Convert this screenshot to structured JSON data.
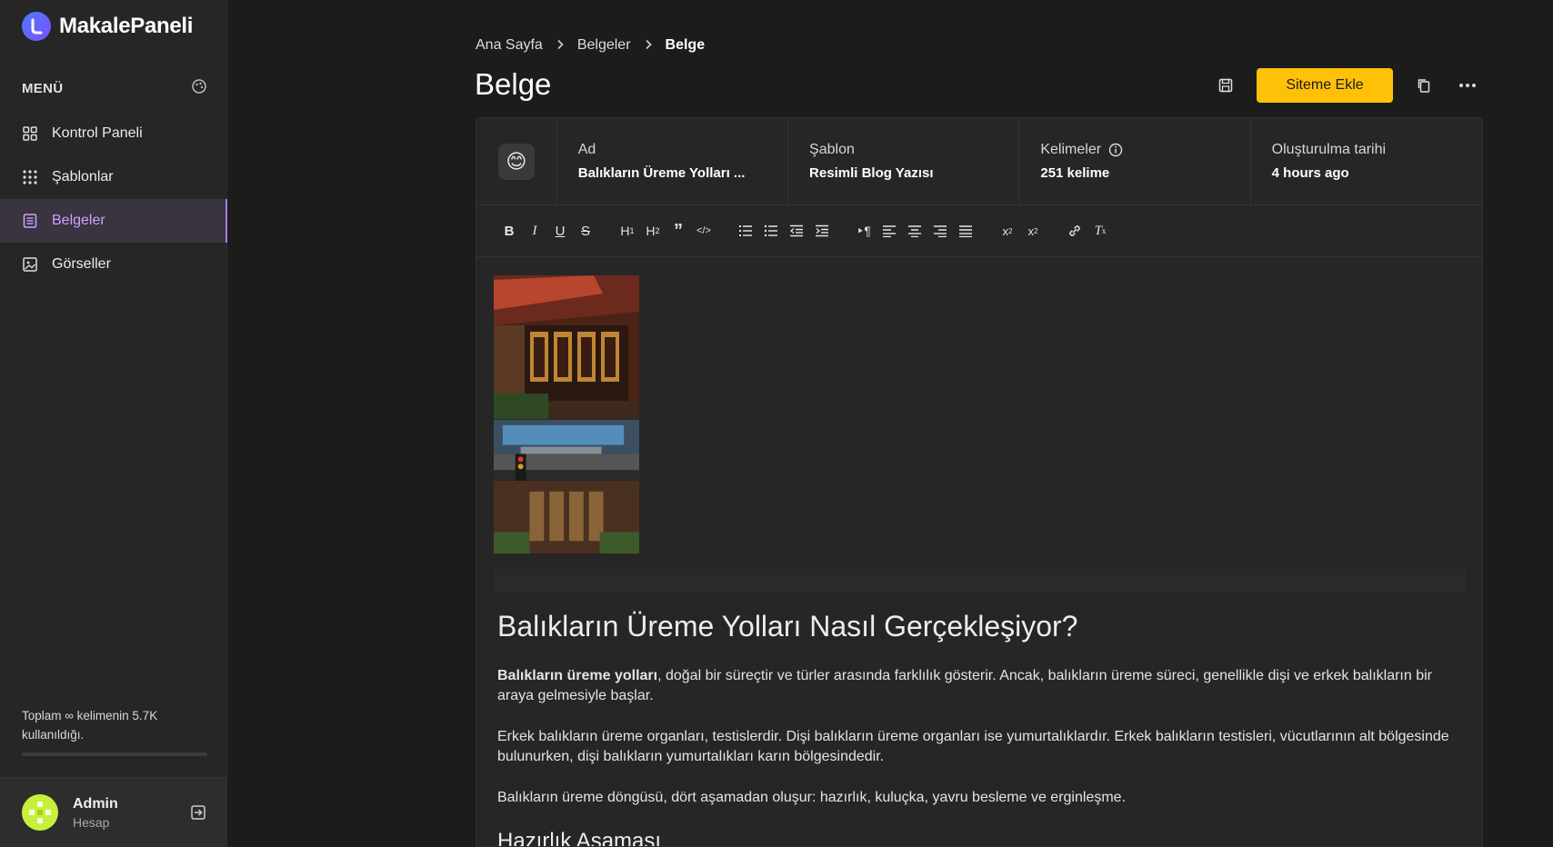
{
  "app": {
    "name": "MakalePaneli"
  },
  "sidebar": {
    "menu_label": "MENÜ",
    "items": [
      {
        "label": "Kontrol Paneli",
        "icon": "grid-icon"
      },
      {
        "label": "Şablonlar",
        "icon": "dots-grid-icon"
      },
      {
        "label": "Belgeler",
        "icon": "document-icon",
        "active": true
      },
      {
        "label": "Görseller",
        "icon": "image-icon"
      }
    ],
    "usage_text": "Toplam ∞ kelimenin 5.7K kullanıldığı.",
    "usage_fraction": 0,
    "user": {
      "name": "Admin",
      "role": "Hesap"
    }
  },
  "breadcrumb": [
    "Ana Sayfa",
    "Belgeler",
    "Belge"
  ],
  "page": {
    "title": "Belge",
    "primary_action": "Siteme Ekle"
  },
  "document": {
    "emoji": "😊",
    "meta": [
      {
        "label": "Ad",
        "value": "Balıkların Üreme Yolları ..."
      },
      {
        "label": "Şablon",
        "value": "Resimli Blog Yazısı"
      },
      {
        "label": "Kelimeler",
        "value": "251 kelime",
        "has_info": true
      },
      {
        "label": "Oluşturulma tarihi",
        "value": "4 hours ago"
      }
    ],
    "toolbar": [
      "B",
      "I",
      "U",
      "S",
      "H1",
      "H2",
      "quote",
      "code",
      "ol",
      "ul",
      "outdent",
      "indent",
      "rtl",
      "align-left",
      "align-center",
      "align-right",
      "justify",
      "sub",
      "sup",
      "link",
      "clear-format"
    ],
    "heading": "Balıkların Üreme Yolları Nasıl Gerçekleşiyor?",
    "p1_bold": "Balıkların üreme yolları",
    "p1_rest": ", doğal bir süreçtir ve türler arasında farklılık gösterir. Ancak, balıkların üreme süreci, genellikle dişi ve erkek balıkların bir araya gelmesiyle başlar.",
    "p2": "Erkek balıkların üreme organları, testislerdir. Dişi balıkların üreme organları ise yumurtalıklardır. Erkek balıkların testisleri, vücutlarının alt bölgesinde bulunurken, dişi balıkların yumurtalıkları karın bölgesindedir.",
    "p3": "Balıkların üreme döngüsü, dört aşamadan oluşur: hazırlık, kuluçka, yavru besleme ve erginleşme.",
    "h2": "Hazırlık Aşaması"
  },
  "colors": {
    "accent": "#ffc107",
    "active_nav": "#c9a3ff",
    "background": "#1c1c1c",
    "panel": "#262626"
  }
}
